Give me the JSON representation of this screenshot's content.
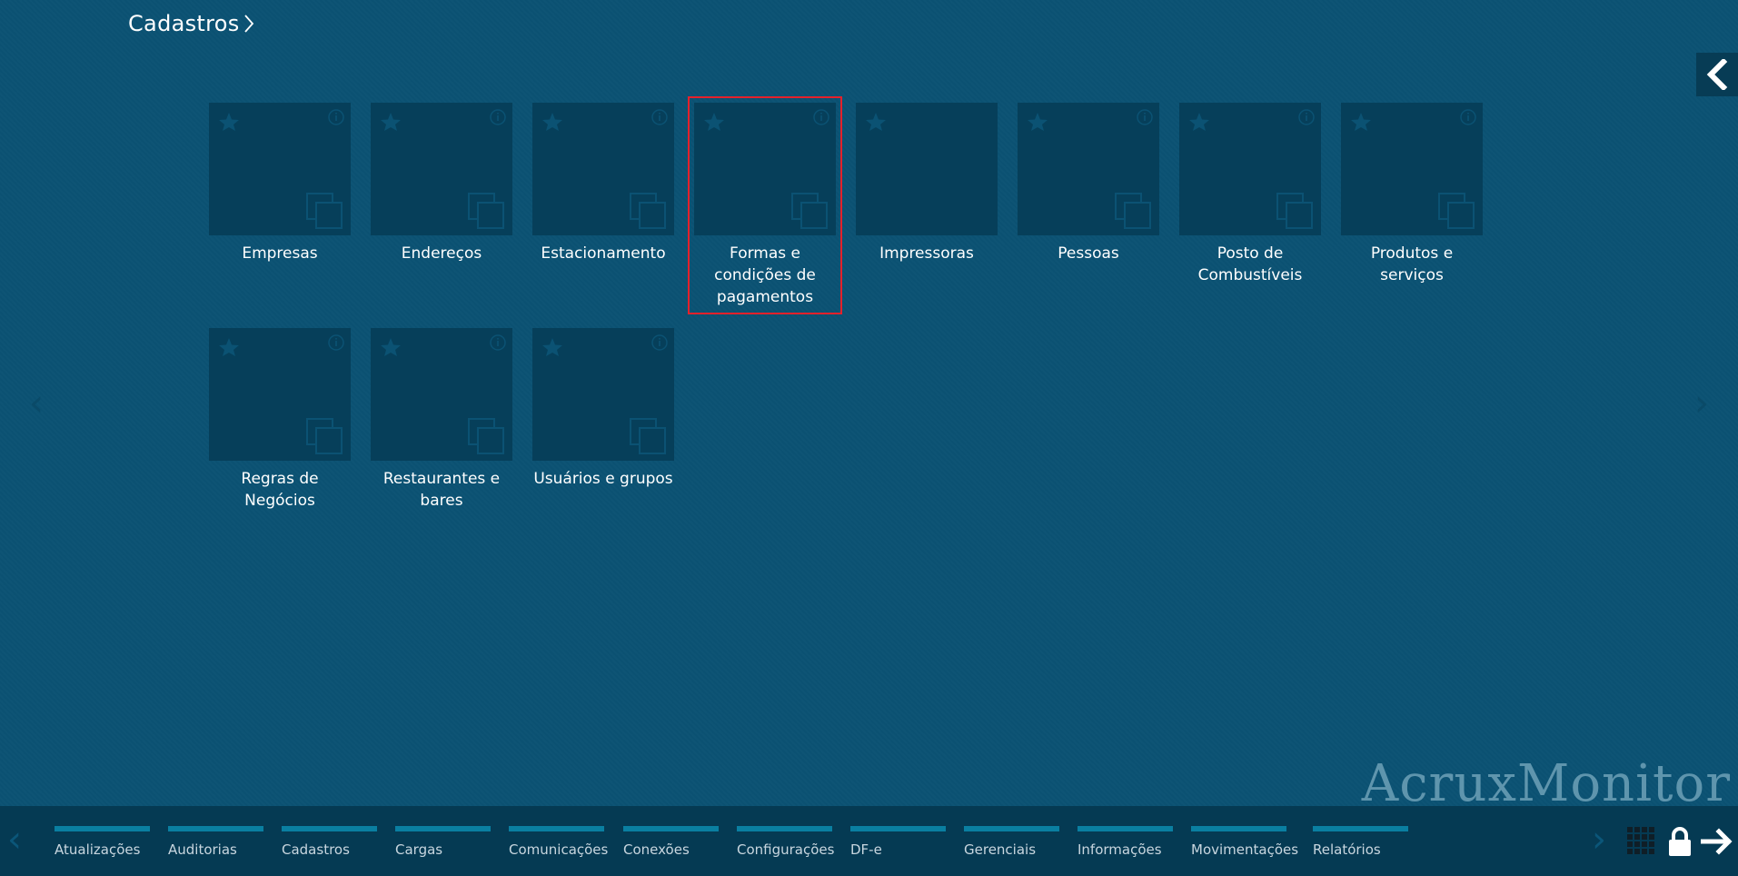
{
  "breadcrumb": {
    "title": "Cadastros"
  },
  "tiles": [
    {
      "label": "Empresas"
    },
    {
      "label": "Endereços"
    },
    {
      "label": "Estacionamento"
    },
    {
      "label": "Formas e condições de pagamentos"
    },
    {
      "label": "Impressoras"
    },
    {
      "label": "Pessoas"
    },
    {
      "label": "Posto de Combustíveis"
    },
    {
      "label": "Produtos e serviços"
    },
    {
      "label": "Regras de Negócios"
    },
    {
      "label": "Restaurantes e bares"
    },
    {
      "label": "Usuários e grupos"
    }
  ],
  "watermark": "AcruxMonitor",
  "bottom_nav": [
    {
      "label": "Atualizações"
    },
    {
      "label": "Auditorias"
    },
    {
      "label": "Cadastros"
    },
    {
      "label": "Cargas"
    },
    {
      "label": "Comunicações"
    },
    {
      "label": "Conexões"
    },
    {
      "label": "Configurações"
    },
    {
      "label": "DF-e"
    },
    {
      "label": "Gerenciais"
    },
    {
      "label": "Informações"
    },
    {
      "label": "Movimentações"
    },
    {
      "label": "Relatórios"
    }
  ],
  "colors": {
    "background": "#0b5273",
    "tile": "#063f5a",
    "selection": "#e5212b",
    "bottom_bar": "#053a53",
    "nav_accent": "#0a7fa1"
  }
}
